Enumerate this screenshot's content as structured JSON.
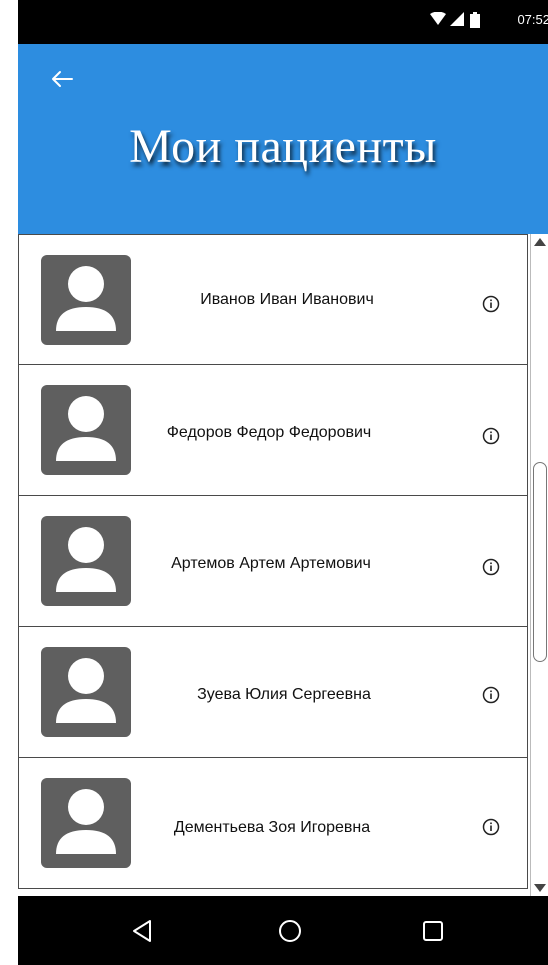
{
  "status_bar": {
    "time": "07:52"
  },
  "app_bar": {
    "title": "Мои пациенты"
  },
  "patients": [
    {
      "name": "Иванов Иван Иванович"
    },
    {
      "name": "Федоров Федор Федорович"
    },
    {
      "name": "Артемов Артем Артемович"
    },
    {
      "name": "Зуева Юлия Сергеевна"
    },
    {
      "name": "Дементьева Зоя Игоревна"
    }
  ],
  "colors": {
    "app_bar": "#2d8de0",
    "avatar": "#5f5f5f",
    "nav_bar": "#000000"
  },
  "icons": {
    "back": "arrow-left-icon",
    "info": "info-icon",
    "avatar": "person-icon",
    "nav": [
      "back-triangle-icon",
      "home-circle-icon",
      "recents-square-icon"
    ]
  }
}
